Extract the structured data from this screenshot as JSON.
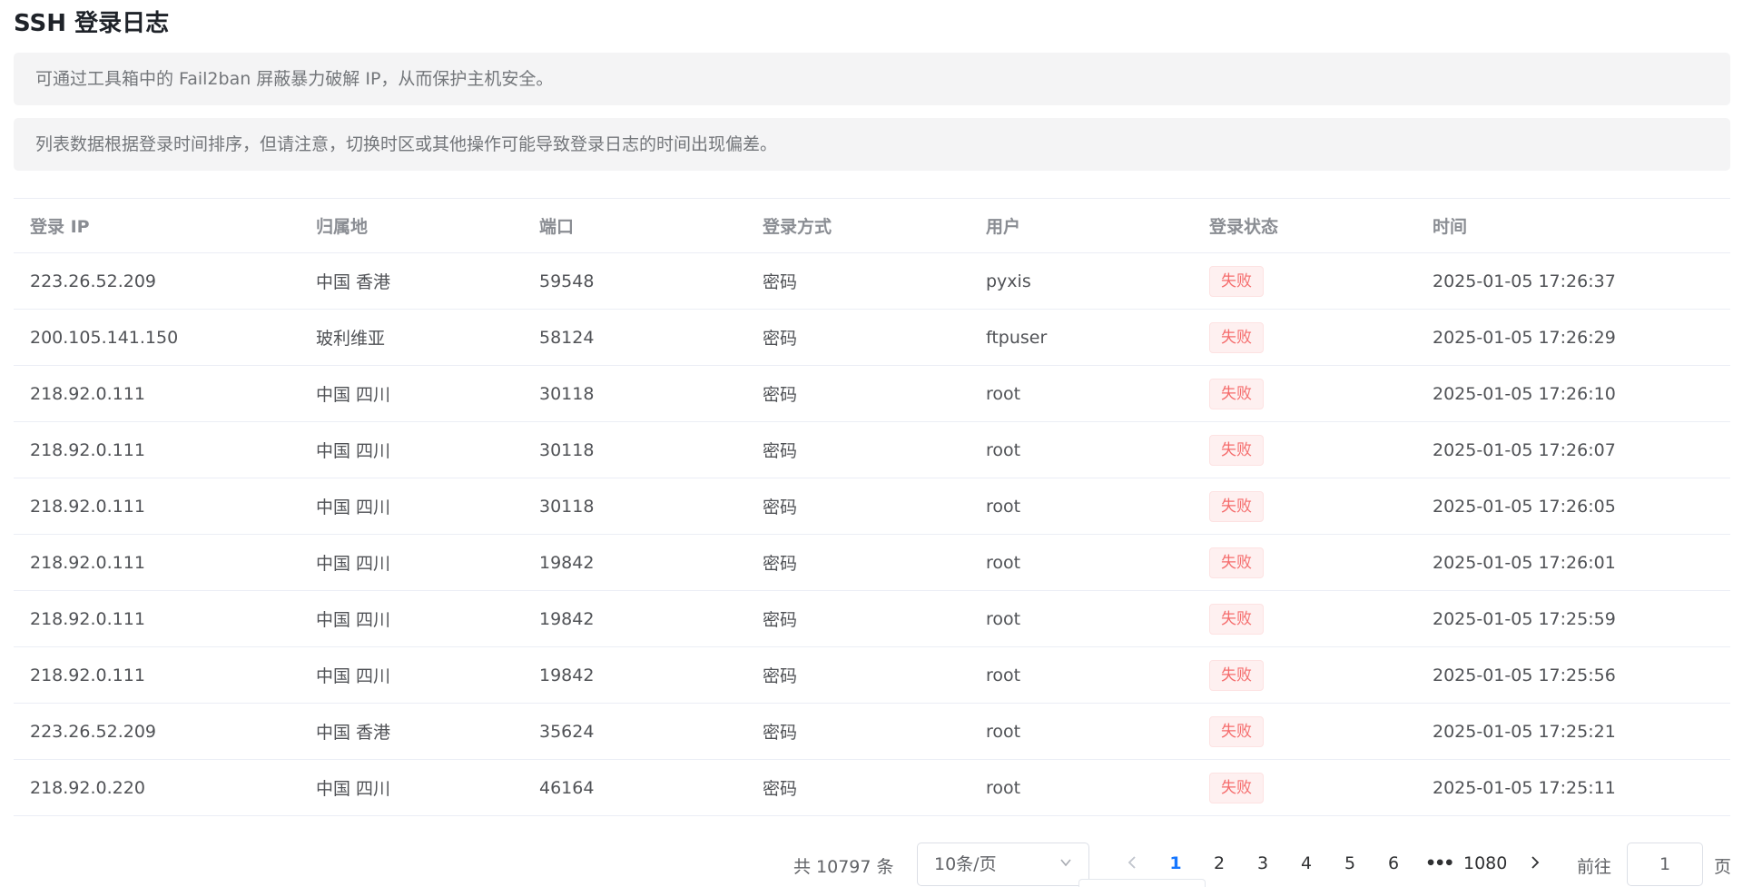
{
  "page": {
    "title": "SSH 登录日志"
  },
  "alerts": [
    "可通过工具箱中的 Fail2ban 屏蔽暴力破解 IP，从而保护主机安全。",
    "列表数据根据登录时间排序，但请注意，切换时区或其他操作可能导致登录日志的时间出现偏差。"
  ],
  "table": {
    "headers": [
      "登录 IP",
      "归属地",
      "端口",
      "登录方式",
      "用户",
      "登录状态",
      "时间"
    ],
    "rows": [
      [
        "223.26.52.209",
        "中国 香港",
        "59548",
        "密码",
        "pyxis",
        "失败",
        "2025-01-05 17:26:37"
      ],
      [
        "200.105.141.150",
        "玻利维亚",
        "58124",
        "密码",
        "ftpuser",
        "失败",
        "2025-01-05 17:26:29"
      ],
      [
        "218.92.0.111",
        "中国 四川",
        "30118",
        "密码",
        "root",
        "失败",
        "2025-01-05 17:26:10"
      ],
      [
        "218.92.0.111",
        "中国 四川",
        "30118",
        "密码",
        "root",
        "失败",
        "2025-01-05 17:26:07"
      ],
      [
        "218.92.0.111",
        "中国 四川",
        "30118",
        "密码",
        "root",
        "失败",
        "2025-01-05 17:26:05"
      ],
      [
        "218.92.0.111",
        "中国 四川",
        "19842",
        "密码",
        "root",
        "失败",
        "2025-01-05 17:26:01"
      ],
      [
        "218.92.0.111",
        "中国 四川",
        "19842",
        "密码",
        "root",
        "失败",
        "2025-01-05 17:25:59"
      ],
      [
        "218.92.0.111",
        "中国 四川",
        "19842",
        "密码",
        "root",
        "失败",
        "2025-01-05 17:25:56"
      ],
      [
        "223.26.52.209",
        "中国 香港",
        "35624",
        "密码",
        "root",
        "失败",
        "2025-01-05 17:25:21"
      ],
      [
        "218.92.0.220",
        "中国 四川",
        "46164",
        "密码",
        "root",
        "失败",
        "2025-01-05 17:25:11"
      ]
    ]
  },
  "pagination": {
    "total_label": "共 10797 条",
    "page_size": "10条/页",
    "prev_icon": "chevron-left-icon",
    "pages": [
      "1",
      "2",
      "3",
      "4",
      "5",
      "6"
    ],
    "ellipsis": "•••",
    "last_page": "1080",
    "next_icon": "chevron-right-icon",
    "current_page": "1",
    "goto_label": "前往",
    "goto_value": "1",
    "goto_suffix": "页"
  },
  "colors": {
    "accent": "#1677ff",
    "fail_text": "#f56c6c",
    "fail_bg": "#fef0f0",
    "alert_bg": "#f4f4f5"
  }
}
